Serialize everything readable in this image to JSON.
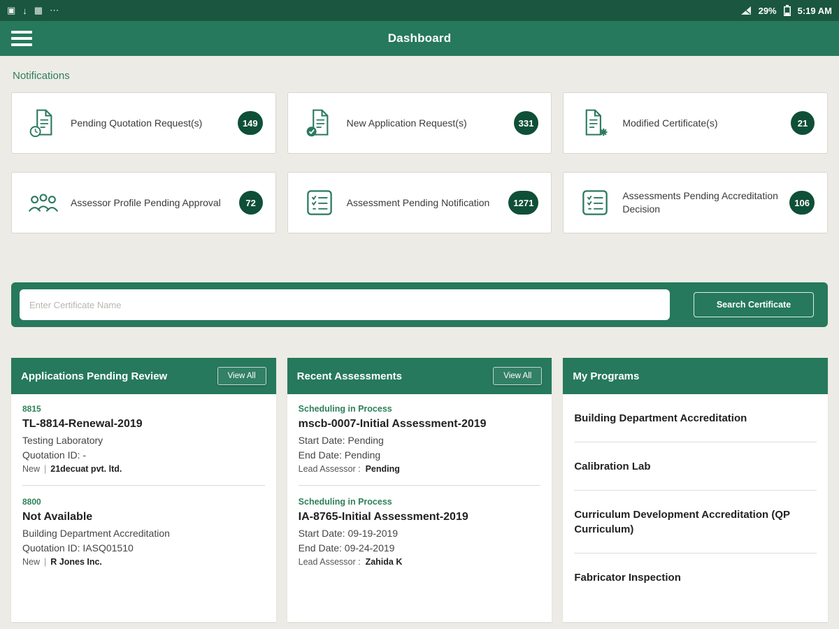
{
  "status_bar": {
    "time": "5:19 AM",
    "battery": "29%"
  },
  "app_bar": {
    "title": "Dashboard"
  },
  "notifications": {
    "section_title": "Notifications",
    "cards": [
      {
        "label": "Pending Quotation Request(s)",
        "count": "149",
        "icon": "document-clock-icon"
      },
      {
        "label": "New Application Request(s)",
        "count": "331",
        "icon": "document-check-icon"
      },
      {
        "label": "Modified Certificate(s)",
        "count": "21",
        "icon": "document-gear-icon"
      },
      {
        "label": "Assessor Profile Pending Approval",
        "count": "72",
        "icon": "people-icon"
      },
      {
        "label": "Assessment Pending Notification",
        "count": "1271",
        "icon": "checklist-icon"
      },
      {
        "label": "Assessments Pending Accreditation Decision",
        "count": "106",
        "icon": "checklist-icon"
      }
    ]
  },
  "search": {
    "placeholder": "Enter Certificate Name",
    "button_label": "Search Certificate"
  },
  "separator": "|",
  "panels": {
    "applications": {
      "title": "Applications Pending Review",
      "view_all": "View All",
      "items": [
        {
          "id": "8815",
          "title": "TL-8814-Renewal-2019",
          "line1": "Testing Laboratory",
          "line2": "Quotation ID:  -",
          "status": "New",
          "company": "21decuat pvt. ltd."
        },
        {
          "id": "8800",
          "title": "Not Available",
          "line1": "Building Department Accreditation",
          "line2": "Quotation ID:  IASQ01510",
          "status": "New",
          "company": "R Jones Inc."
        }
      ]
    },
    "assessments": {
      "title": "Recent Assessments",
      "view_all": "View All",
      "items": [
        {
          "status": "Scheduling in Process",
          "title": "mscb-0007-Initial Assessment-2019",
          "start": "Start Date: Pending",
          "end": "End Date: Pending",
          "lead_label": "Lead Assessor :",
          "lead": "Pending"
        },
        {
          "status": "Scheduling in Process",
          "title": "IA-8765-Initial Assessment-2019",
          "start": "Start Date: 09-19-2019",
          "end": "End Date: 09-24-2019",
          "lead_label": "Lead Assessor :",
          "lead": "Zahida K"
        }
      ]
    },
    "programs": {
      "title": "My Programs",
      "items": [
        "Building Department Accreditation",
        "Calibration Lab",
        "Curriculum Development Accreditation (QP Curriculum)",
        "Fabricator Inspection"
      ]
    }
  }
}
